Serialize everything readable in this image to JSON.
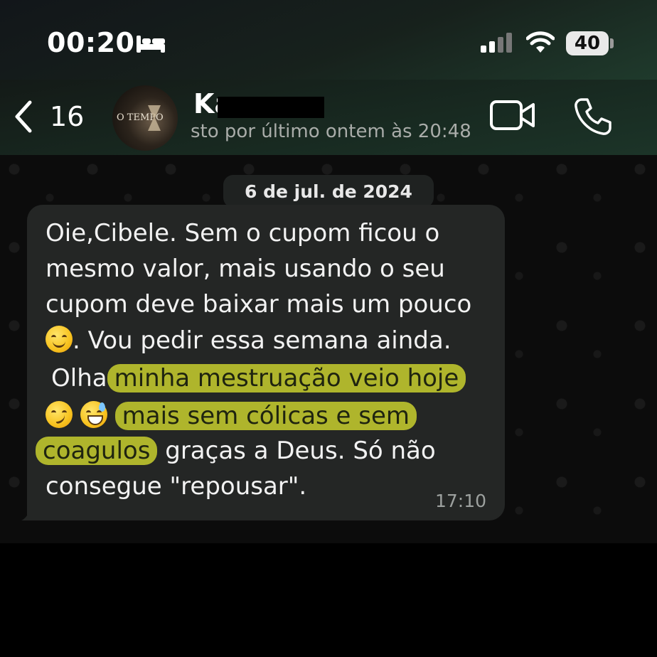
{
  "status_bar": {
    "time": "00:20",
    "battery": "40",
    "icons": [
      "bed-icon",
      "signal-icon",
      "wifi-icon",
      "battery-icon"
    ]
  },
  "header": {
    "back_count": "16",
    "avatar_text": "O TEMPO",
    "contact_name": "Ka",
    "last_seen": "sto por último ontem às 20:48",
    "icons": [
      "chevron-left-icon",
      "video-call-icon",
      "phone-icon"
    ]
  },
  "chat": {
    "date_chip": "6 de jul. de 2024",
    "message": {
      "line1": "Oie,Cibele. Sem o cupom ficou o",
      "line2": "mesmo valor, mais usando o seu",
      "line3": "cupom deve baixar mais um pouco",
      "line4_after_emoji": ". Vou pedir essa semana ainda.",
      "line5_plain": "Olha",
      "line5_highlight": "minha mestruação veio hoje",
      "line6_highlight": "mais sem cólicas e sem",
      "line7_highlight": "coagulos",
      "line7_plain": "graças a Deus. Só não",
      "line8": "consegue \"repousar\".",
      "time": "17:10",
      "emojis": [
        "smiling-face-emoji",
        "smirking-face-emoji",
        "grinning-sweat-emoji"
      ]
    },
    "colors": {
      "highlight": "#ced62e",
      "bubble": "#242625"
    }
  }
}
